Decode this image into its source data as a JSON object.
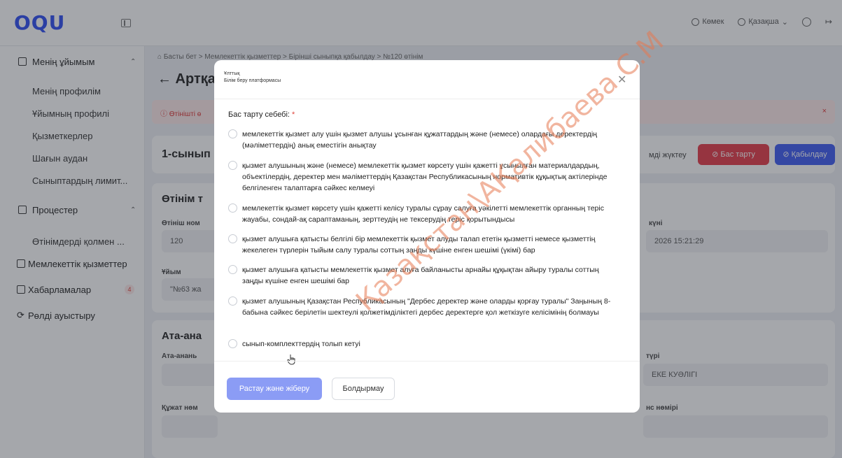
{
  "app": {
    "logo": "OQU"
  },
  "header": {
    "help": "Көмек",
    "language": "Қазақша"
  },
  "sidebar": {
    "section1": "Менің ұйымым",
    "section1_items": [
      "Менің профилім",
      "Ұйымның профилі",
      "Қызметкерлер",
      "Шағын аудан",
      "Сыныптардың лимит..."
    ],
    "section2": "Процестер",
    "section2_items": [
      "Өтінімдерді қолмен ..."
    ],
    "gov_services": "Мемлекеттік қызметтер",
    "messages": "Хабарламалар",
    "messages_badge": "4",
    "switch_role": "Рөлді ауыстыру"
  },
  "main": {
    "breadcrumb": "Басты бет  >  Мемлекеттік қызметтер  >  Бірінші сыныпқа қабылдау  >  №120 өтінім",
    "back": "← Артқа",
    "alert": "Өтінішті ө",
    "card_title": "1-сынып",
    "upload_btn": "мді жүктеу",
    "reject_btn": "Бас тарту",
    "accept_btn": "Қабылдау",
    "section_title": "Өтінім т",
    "app_number_label": "Өтініш ном",
    "app_number": "120",
    "date_label": "күні",
    "date_value": "2026 15:21:29",
    "org_label": "Ұйым",
    "org_value": "\"№63 жа",
    "parent_title": "Ата-ана",
    "parent_label": "Ата-анань",
    "doc_type_label": "түрі",
    "doc_type_value": "ЕКЕ КУӘЛІГІ",
    "doc_number_label": "Құжат нөм",
    "doc_series_label": "нс нөмірі"
  },
  "modal": {
    "header_line1": "Ұлттық",
    "header_line2": "Білім беру платформасы",
    "label": "Бас тарту себебі:",
    "required_mark": "*",
    "options": [
      "мемлекеттік қызмет алу үшін қызмет алушы ұсынған құжаттардың және (немесе) олардағы деректердің (мәліметтердің) анық еместігін анықтау",
      "қызмет алушының және (немесе) мемлекеттік қызмет көрсету үшін қажетті ұсынылған материалдардың, объектілердің, деректер мен мәліметтердің Қазақстан Республикасының нормативтік құқықтық актілерінде белгіленген талаптарға сәйкес келмеуі",
      "мемлекеттік қызмет көрсету үшін қажетті келісу туралы сұрау салуға уәкілетті мемлекеттік органның теріс жауабы, сондай-ақ сараптаманың, зерттеудің не тексерудің теріс қорытындысы",
      "қызмет алушыға қатысты белгілі бір мемлекеттік қызмет алуды талап ететін қызметті немесе қызметтің жекелеген түрлерін тыйым салу туралы соттың заңды күшіне енген шешімі (үкімі) бар",
      "қызмет алушыға қатысты мемлекеттік қызмет алуға байланысты арнайы құқықтан айыру туралы соттың заңды күшіне енген шешімі бар",
      "қызмет алушының Қазақстан Республикасының \"Дербес деректер және оларды қорғау туралы\" Заңының 8-бабына сәйкес берілетін шектеулі қолжетімділіктегі дербес деректерге қол жеткізуге келісімінің болмауы",
      "сынып-комплекттердің толып кетуі"
    ],
    "submit": "Растау және жіберу",
    "cancel": "Болдырмау"
  },
  "watermark": "Қазақстан\\АҚалибаева С.М"
}
